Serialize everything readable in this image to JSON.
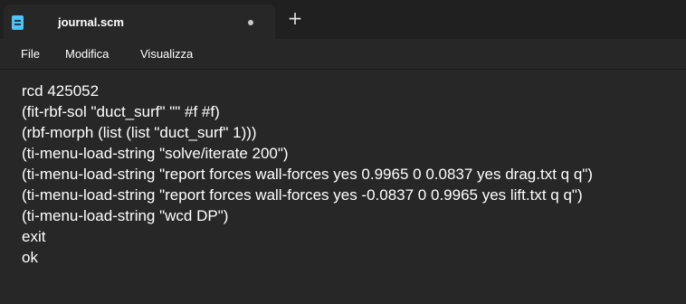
{
  "tab": {
    "title": "journal.scm",
    "new_tab_label": "+"
  },
  "menu": {
    "items": [
      "File",
      "Modifica",
      "Visualizza"
    ]
  },
  "editor": {
    "lines": [
      "rcd 425052",
      "(fit-rbf-sol \"duct_surf\" \"\" #f #f)",
      "(rbf-morph (list (list \"duct_surf\" 1)))",
      "(ti-menu-load-string \"solve/iterate 200\")",
      "(ti-menu-load-string \"report forces wall-forces yes 0.9965 0 0.0837 yes drag.txt q q\")",
      "(ti-menu-load-string \"report forces wall-forces yes -0.0837 0 0.9965 yes lift.txt q q\")",
      "(ti-menu-load-string \"wcd DP\")",
      "exit",
      "ok"
    ]
  },
  "colors": {
    "background": "#272727",
    "titlebar": "#202020",
    "file_icon": "#4fc3f7",
    "text": "#ffffff"
  }
}
